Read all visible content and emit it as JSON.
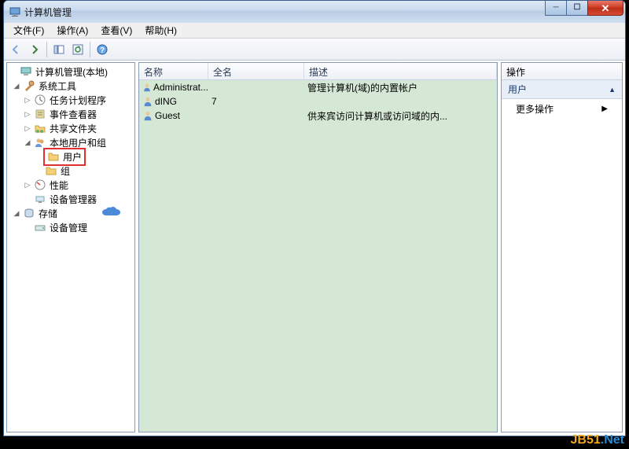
{
  "window": {
    "title": "计算机管理"
  },
  "menu": {
    "file": "文件(F)",
    "action": "操作(A)",
    "view": "查看(V)",
    "help": "帮助(H)"
  },
  "tree": {
    "root": "计算机管理(本地)",
    "sys_tools": "系统工具",
    "task_sched": "任务计划程序",
    "event_viewer": "事件查看器",
    "shared": "共享文件夹",
    "local_users": "本地用户和组",
    "users": "用户",
    "groups": "组",
    "perf": "性能",
    "dev_mgr": "设备管理器",
    "storage": "存储",
    "disk_mgr": "设备管理"
  },
  "list": {
    "col_name": "名称",
    "col_full": "全名",
    "col_desc": "描述",
    "rows": [
      {
        "name": "Administrat...",
        "full": "",
        "desc": "管理计算机(域)的内置帐户"
      },
      {
        "name": "dING",
        "full": "7",
        "desc": ""
      },
      {
        "name": "Guest",
        "full": "",
        "desc": "供来宾访问计算机或访问域的内..."
      }
    ]
  },
  "actions": {
    "header": "操作",
    "section": "用户",
    "more": "更多操作"
  },
  "watermark": {
    "a": "JB51",
    "b": ".Net"
  }
}
